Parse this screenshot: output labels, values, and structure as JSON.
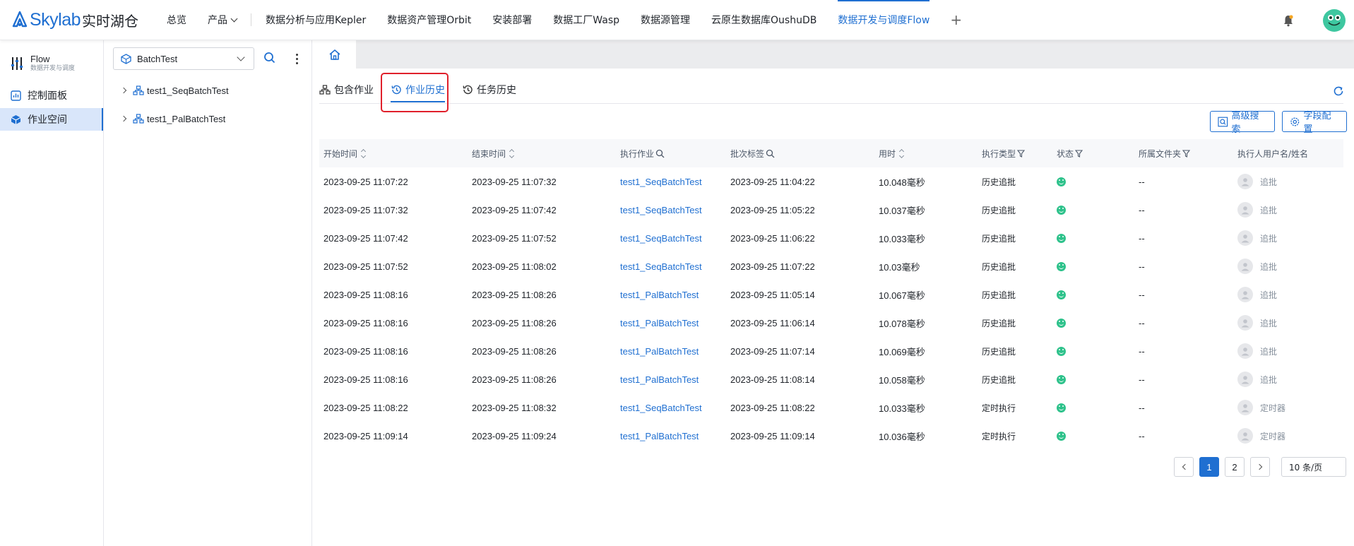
{
  "brand": {
    "name_en": "Skylab",
    "name_cn": "实时湖仓",
    "color": "#1f6fd1"
  },
  "nav": {
    "items": [
      {
        "label": "总览"
      },
      {
        "label": "产品"
      },
      {
        "label": "数据分析与应用Kepler"
      },
      {
        "label": "数据资产管理Orbit"
      },
      {
        "label": "安装部署"
      },
      {
        "label": "数据工厂Wasp"
      },
      {
        "label": "数据源管理"
      },
      {
        "label": "云原生数据库OushuDB"
      },
      {
        "label": "数据开发与调度Flow"
      }
    ],
    "active": "数据开发与调度Flow",
    "plus": "+"
  },
  "sidebar": {
    "app_title": "Flow",
    "app_subtitle": "数据开发与调度",
    "items": [
      {
        "label": "控制面板",
        "icon": "dashboard-icon"
      },
      {
        "label": "作业空间",
        "icon": "cube-icon",
        "active": true
      }
    ]
  },
  "tree": {
    "project": "BatchTest",
    "nodes": [
      {
        "label": "test1_SeqBatchTest"
      },
      {
        "label": "test1_PalBatchTest"
      }
    ]
  },
  "tabs": {
    "items": [
      {
        "label": "包含作业",
        "icon": "workflow-icon"
      },
      {
        "label": "作业历史",
        "icon": "history-icon",
        "active": true
      },
      {
        "label": "任务历史",
        "icon": "history-icon"
      }
    ]
  },
  "toolbar": {
    "advanced_search": "高级搜索",
    "field_config": "字段配置"
  },
  "table": {
    "columns": [
      "开始时间",
      "结束时间",
      "执行作业",
      "批次标签",
      "用时",
      "执行类型",
      "状态",
      "所属文件夹",
      "执行人用户名/姓名"
    ],
    "rows": [
      {
        "start": "2023-09-25 11:07:22",
        "end": "2023-09-25 11:07:32",
        "job": "test1_SeqBatchTest",
        "batch": "2023-09-25 11:04:22",
        "duration": "10.048毫秒",
        "type": "历史追批",
        "status": "success",
        "folder": "--",
        "user": "追批"
      },
      {
        "start": "2023-09-25 11:07:32",
        "end": "2023-09-25 11:07:42",
        "job": "test1_SeqBatchTest",
        "batch": "2023-09-25 11:05:22",
        "duration": "10.037毫秒",
        "type": "历史追批",
        "status": "success",
        "folder": "--",
        "user": "追批"
      },
      {
        "start": "2023-09-25 11:07:42",
        "end": "2023-09-25 11:07:52",
        "job": "test1_SeqBatchTest",
        "batch": "2023-09-25 11:06:22",
        "duration": "10.033毫秒",
        "type": "历史追批",
        "status": "success",
        "folder": "--",
        "user": "追批"
      },
      {
        "start": "2023-09-25 11:07:52",
        "end": "2023-09-25 11:08:02",
        "job": "test1_SeqBatchTest",
        "batch": "2023-09-25 11:07:22",
        "duration": "10.03毫秒",
        "type": "历史追批",
        "status": "success",
        "folder": "--",
        "user": "追批"
      },
      {
        "start": "2023-09-25 11:08:16",
        "end": "2023-09-25 11:08:26",
        "job": "test1_PalBatchTest",
        "batch": "2023-09-25 11:05:14",
        "duration": "10.067毫秒",
        "type": "历史追批",
        "status": "success",
        "folder": "--",
        "user": "追批"
      },
      {
        "start": "2023-09-25 11:08:16",
        "end": "2023-09-25 11:08:26",
        "job": "test1_PalBatchTest",
        "batch": "2023-09-25 11:06:14",
        "duration": "10.078毫秒",
        "type": "历史追批",
        "status": "success",
        "folder": "--",
        "user": "追批"
      },
      {
        "start": "2023-09-25 11:08:16",
        "end": "2023-09-25 11:08:26",
        "job": "test1_PalBatchTest",
        "batch": "2023-09-25 11:07:14",
        "duration": "10.069毫秒",
        "type": "历史追批",
        "status": "success",
        "folder": "--",
        "user": "追批"
      },
      {
        "start": "2023-09-25 11:08:16",
        "end": "2023-09-25 11:08:26",
        "job": "test1_PalBatchTest",
        "batch": "2023-09-25 11:08:14",
        "duration": "10.058毫秒",
        "type": "历史追批",
        "status": "success",
        "folder": "--",
        "user": "追批"
      },
      {
        "start": "2023-09-25 11:08:22",
        "end": "2023-09-25 11:08:32",
        "job": "test1_SeqBatchTest",
        "batch": "2023-09-25 11:08:22",
        "duration": "10.033毫秒",
        "type": "定时执行",
        "status": "success",
        "folder": "--",
        "user": "定时器"
      },
      {
        "start": "2023-09-25 11:09:14",
        "end": "2023-09-25 11:09:24",
        "job": "test1_PalBatchTest",
        "batch": "2023-09-25 11:09:14",
        "duration": "10.036毫秒",
        "type": "定时执行",
        "status": "success",
        "folder": "--",
        "user": "定时器"
      }
    ]
  },
  "pagination": {
    "pages": [
      "1",
      "2"
    ],
    "current": "1",
    "page_size": "10 条/页"
  },
  "colors": {
    "accent": "#1f6fd1",
    "success": "#2ec28b",
    "highlight": "#e0202b"
  }
}
